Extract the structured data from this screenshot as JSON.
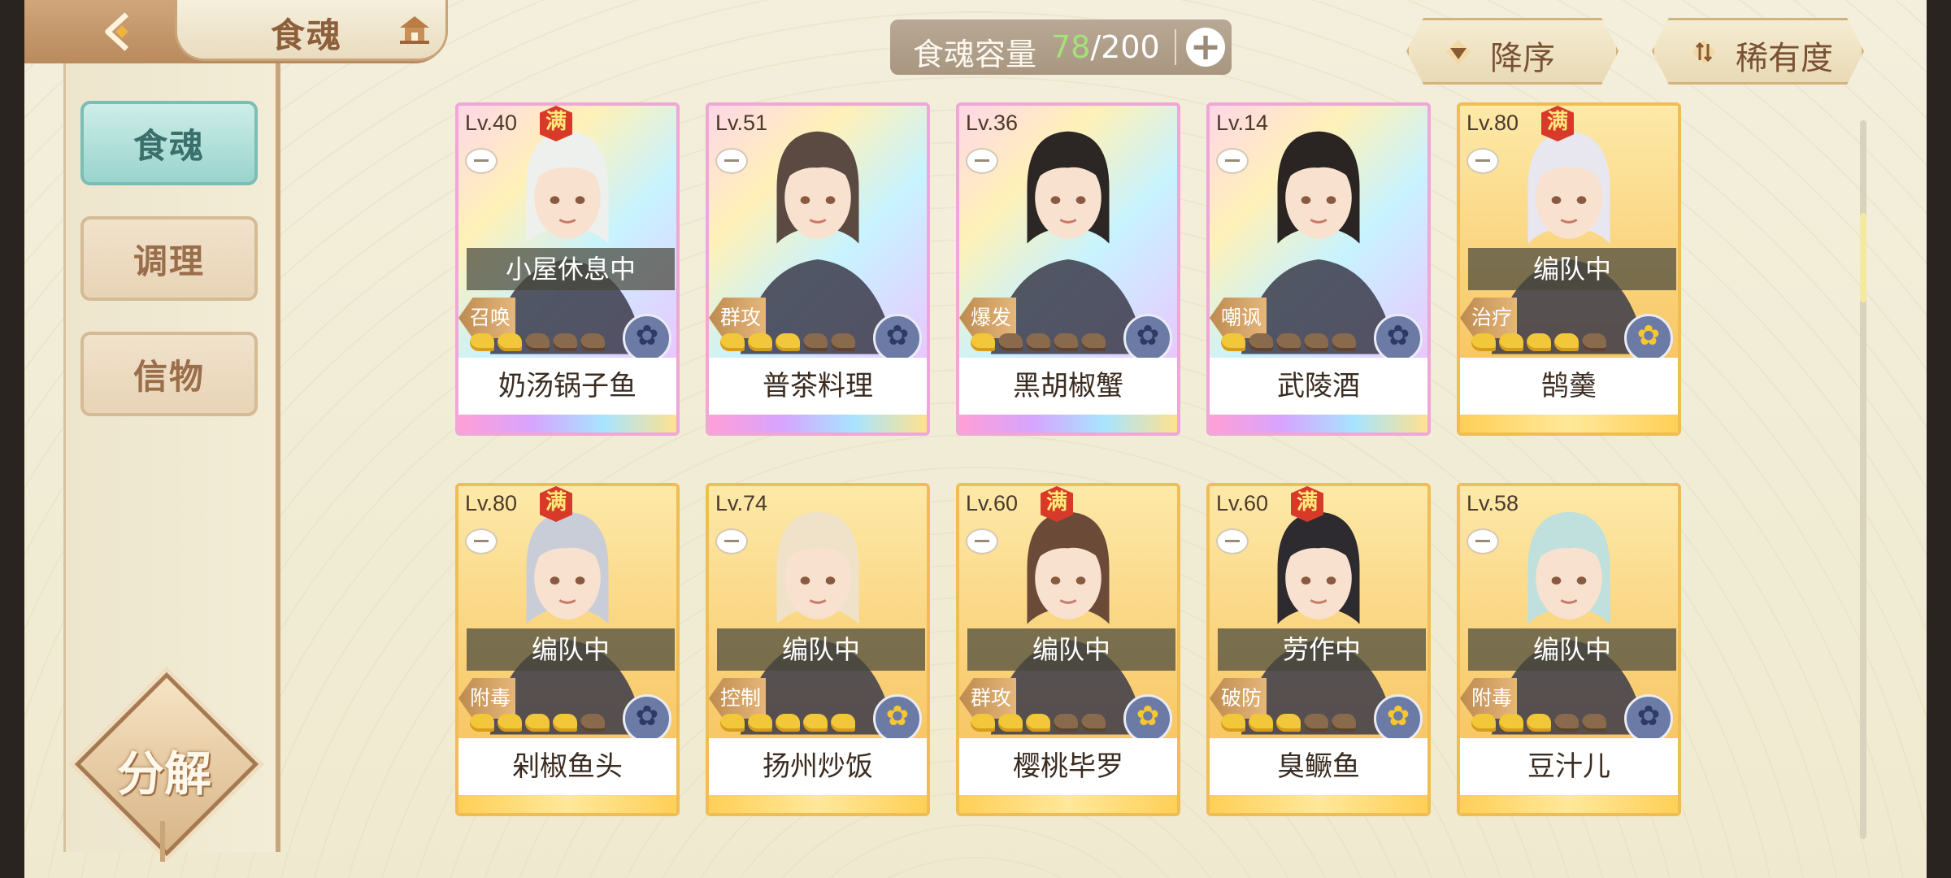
{
  "header": {
    "title": "食魂",
    "capacity_label": "食魂容量",
    "capacity_current": "78",
    "capacity_total": "/200",
    "sort_order_label": "降序",
    "sort_key_label": "稀有度"
  },
  "sidebar": {
    "items": [
      {
        "label": "食魂",
        "active": true
      },
      {
        "label": "调理",
        "active": false
      },
      {
        "label": "信物",
        "active": false
      }
    ],
    "decompose_label": "分解"
  },
  "colors": {
    "accent_teal": "#9ad3cd",
    "capacity_current": "#a6e07a",
    "full_badge": "#d83a2a"
  },
  "cards": [
    {
      "level": "Lv.40",
      "full": true,
      "full_label": "满",
      "status": "小屋休息中",
      "role": "召唤",
      "stars_on": 2,
      "stars_total": 5,
      "name": "奶汤锅子鱼",
      "rarity": "UR",
      "element": "dark-icon"
    },
    {
      "level": "Lv.51",
      "full": false,
      "full_label": "",
      "status": "",
      "role": "群攻",
      "stars_on": 3,
      "stars_total": 5,
      "name": "普茶料理",
      "rarity": "UR",
      "element": "dark-icon"
    },
    {
      "level": "Lv.36",
      "full": false,
      "full_label": "",
      "status": "",
      "role": "爆发",
      "stars_on": 1,
      "stars_total": 5,
      "name": "黑胡椒蟹",
      "rarity": "UR",
      "element": "dark-icon"
    },
    {
      "level": "Lv.14",
      "full": false,
      "full_label": "",
      "status": "",
      "role": "嘲讽",
      "stars_on": 1,
      "stars_total": 5,
      "name": "武陵酒",
      "rarity": "UR",
      "element": "dark-icon"
    },
    {
      "level": "Lv.80",
      "full": true,
      "full_label": "满",
      "status": "编队中",
      "role": "治疗",
      "stars_on": 4,
      "stars_total": 5,
      "name": "鹄羹",
      "rarity": "SP",
      "element": "light-icon"
    },
    {
      "level": "Lv.80",
      "full": true,
      "full_label": "满",
      "status": "编队中",
      "role": "附毒",
      "stars_on": 4,
      "stars_total": 5,
      "name": "剁椒鱼头",
      "rarity": "SP",
      "element": "dark-icon"
    },
    {
      "level": "Lv.74",
      "full": false,
      "full_label": "",
      "status": "编队中",
      "role": "控制",
      "stars_on": 5,
      "stars_total": 5,
      "name": "扬州炒饭",
      "rarity": "SP",
      "element": "light-icon"
    },
    {
      "level": "Lv.60",
      "full": true,
      "full_label": "满",
      "status": "编队中",
      "role": "群攻",
      "stars_on": 3,
      "stars_total": 5,
      "name": "樱桃毕罗",
      "rarity": "SP",
      "element": "light-icon"
    },
    {
      "level": "Lv.60",
      "full": true,
      "full_label": "满",
      "status": "劳作中",
      "role": "破防",
      "stars_on": 3,
      "stars_total": 5,
      "name": "臭鳜鱼",
      "rarity": "SP",
      "element": "light-icon"
    },
    {
      "level": "Lv.58",
      "full": false,
      "full_label": "",
      "status": "编队中",
      "role": "附毒",
      "stars_on": 3,
      "stars_total": 5,
      "name": "豆汁儿",
      "rarity": "SP",
      "element": "dark-icon"
    }
  ]
}
